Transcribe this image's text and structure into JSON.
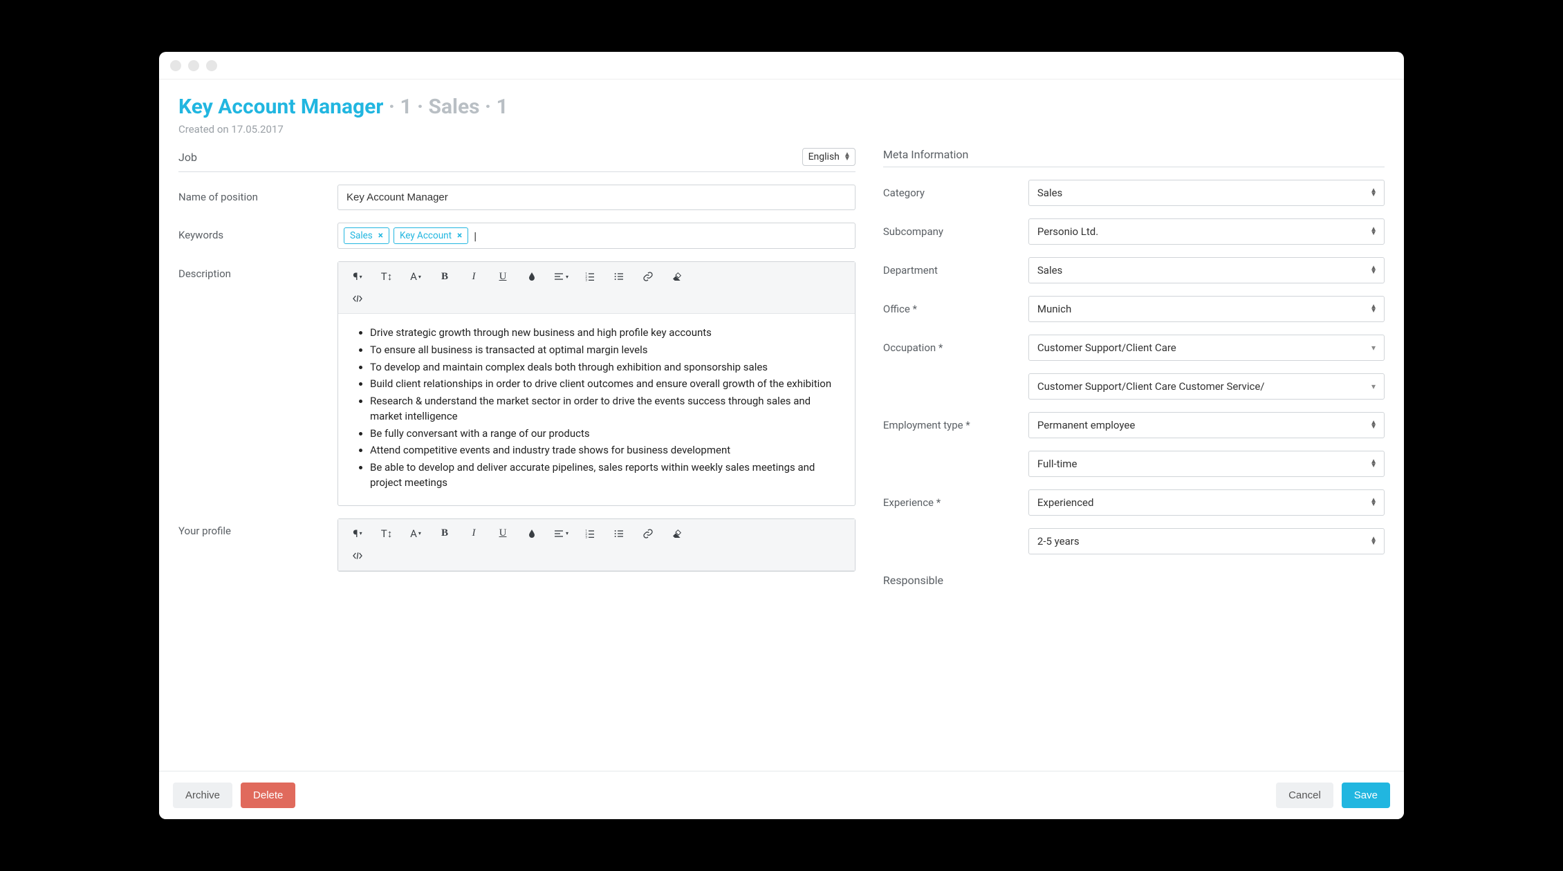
{
  "header": {
    "title_main": "Key Account Manager",
    "title_rest": " · 1 · Sales · 1",
    "created": "Created on 17.05.2017"
  },
  "job": {
    "section_label": "Job",
    "language": "English",
    "name_label": "Name of position",
    "name_value": "Key Account Manager",
    "keywords_label": "Keywords",
    "keywords": [
      "Sales",
      "Key Account"
    ],
    "description_label": "Description",
    "description_items": [
      "Drive strategic growth through new business and high profile key accounts",
      "To ensure all business is transacted at optimal margin levels",
      "To develop and maintain complex deals both through exhibition and sponsorship sales",
      "Build client relationships in order to drive client outcomes and ensure overall growth of the exhibition",
      "Research & understand the market sector in order to drive the events success through sales and market intelligence",
      "Be fully conversant with a range of our products",
      "Attend competitive events and industry trade shows for business development",
      "Be able to develop and deliver accurate pipelines, sales reports within weekly sales meetings and project meetings"
    ],
    "profile_label": "Your profile"
  },
  "meta": {
    "section_label": "Meta Information",
    "category_label": "Category",
    "category_value": "Sales",
    "subcompany_label": "Subcompany",
    "subcompany_value": "Personio Ltd.",
    "department_label": "Department",
    "department_value": "Sales",
    "office_label": "Office *",
    "office_value": "Munich",
    "occupation_label": "Occupation *",
    "occupation_value": "Customer Support/Client Care",
    "occupation_sub_value": "Customer Support/Client Care Customer Service/",
    "employment_label": "Employment type *",
    "employment_value": "Permanent employee",
    "employment_time_value": "Full-time",
    "experience_label": "Experience *",
    "experience_value": "Experienced",
    "experience_years_value": "2-5 years",
    "responsible_label": "Responsible"
  },
  "footer": {
    "archive": "Archive",
    "delete": "Delete",
    "cancel": "Cancel",
    "save": "Save"
  }
}
